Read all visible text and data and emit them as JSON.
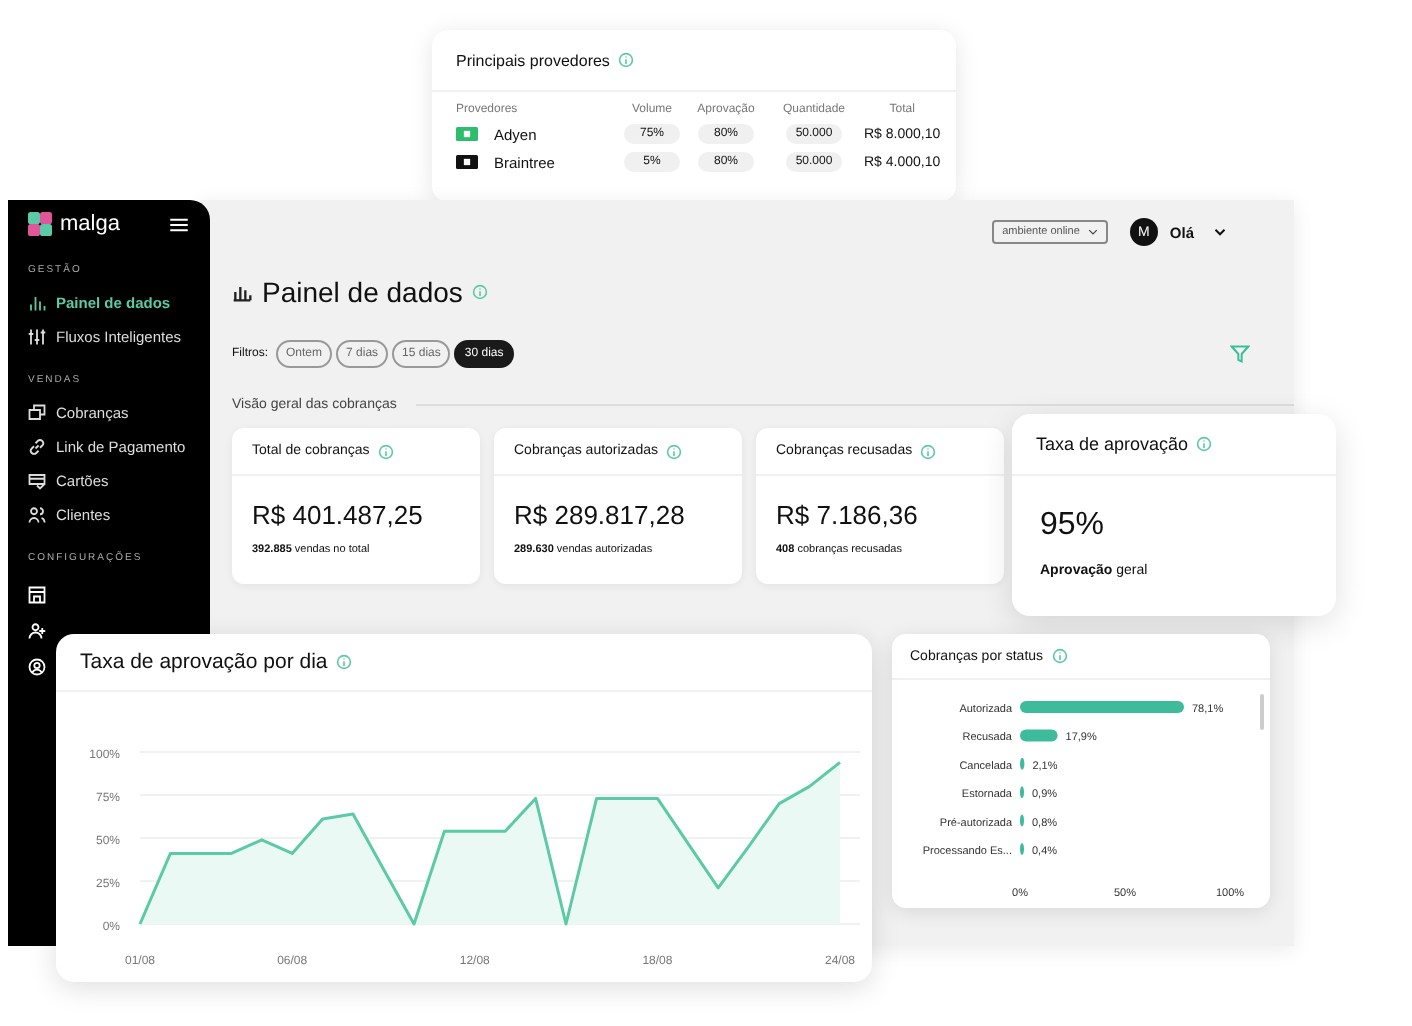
{
  "providers_card": {
    "title": "Principais provedores",
    "columns": [
      "Provedores",
      "Volume",
      "Aprovação",
      "Quantidade",
      "Total"
    ],
    "rows": [
      {
        "name": "Adyen",
        "color": "#2dbe6c",
        "volume": "75%",
        "approval": "80%",
        "quantity": "50.000",
        "total": "R$ 8.000,10"
      },
      {
        "name": "Braintree",
        "color": "#111111",
        "volume": "5%",
        "approval": "80%",
        "quantity": "50.000",
        "total": "R$ 4.000,10"
      }
    ]
  },
  "sidebar": {
    "logo": "malga",
    "sections": [
      {
        "title": "GESTÃO",
        "items": [
          {
            "label": "Painel de dados",
            "selected": true
          },
          {
            "label": "Fluxos Inteligentes",
            "selected": false
          }
        ]
      },
      {
        "title": "VENDAS",
        "items": [
          {
            "label": "Cobranças",
            "selected": false
          },
          {
            "label": "Link de Pagamento",
            "selected": false
          },
          {
            "label": "Cartões",
            "selected": false
          },
          {
            "label": "Clientes",
            "selected": false
          }
        ]
      },
      {
        "title": "CONFIGURAÇÕES"
      }
    ]
  },
  "header": {
    "environment": "ambiente online",
    "avatar": "M",
    "greeting": "Olá"
  },
  "page_title": "Painel de dados",
  "filters": {
    "label": "Filtros:",
    "options": [
      {
        "label": "Ontem",
        "selected": false
      },
      {
        "label": "7 dias",
        "selected": false
      },
      {
        "label": "15 dias",
        "selected": false
      },
      {
        "label": "30 dias",
        "selected": true
      }
    ]
  },
  "overview_title": "Visão geral das cobranças",
  "stat_cards": [
    {
      "title": "Total de cobranças",
      "value": "R$ 401.487,25",
      "note": "**392.885** vendas no total"
    },
    {
      "title": "Cobranças autorizadas",
      "value": "R$ 289.817,28",
      "note": "**289.630** vendas autorizadas"
    },
    {
      "title": "Cobranças recusadas",
      "value": "R$ 7.186,36",
      "note": "**408** cobranças recusadas"
    }
  ],
  "approval_card": {
    "title": "Taxa de aprovação",
    "value": "95%",
    "note": "**Aprovação** geral"
  },
  "status_card": {
    "title": "Cobranças por status",
    "chart_data": {
      "type": "bar",
      "orientation": "horizontal",
      "categories": [
        "Autorizada",
        "Recusada",
        "Cancelada",
        "Estornada",
        "Pré-autorizada",
        "Processando Es..."
      ],
      "values": [
        78.1,
        17.9,
        2.1,
        0.9,
        0.8,
        0.4
      ],
      "value_labels": [
        "78,1%",
        "17,9%",
        "2,1%",
        "0,9%",
        "0,8%",
        "0,4%"
      ],
      "xlim": [
        0,
        100
      ],
      "xticks": [
        {
          "value": 0,
          "label": "0%"
        },
        {
          "value": 50,
          "label": "50%"
        },
        {
          "value": 100,
          "label": "100%"
        }
      ]
    }
  },
  "daily_card": {
    "title": "Taxa de aprovação por dia",
    "chart_data": {
      "type": "area",
      "categories": [
        "01/08",
        null,
        null,
        null,
        null,
        "06/08",
        null,
        null,
        null,
        null,
        null,
        "12/08",
        null,
        null,
        null,
        null,
        null,
        "18/08",
        null,
        null,
        null,
        null,
        null,
        "24/08"
      ],
      "series": [
        {
          "color": "#5cc9a7",
          "values": [
            0,
            41,
            41,
            41,
            49,
            41,
            61,
            64,
            32,
            0,
            54,
            54,
            54,
            73,
            0,
            73,
            73,
            73,
            47,
            21,
            45,
            70,
            80,
            94
          ]
        }
      ],
      "ylim": [
        0,
        100
      ],
      "grid": true,
      "yticks": [
        {
          "value": 0,
          "label": "0%"
        },
        {
          "value": 25,
          "label": "25%"
        },
        {
          "value": 50,
          "label": "50%"
        },
        {
          "value": 75,
          "label": "75%"
        },
        {
          "value": 100,
          "label": "100%"
        }
      ]
    }
  }
}
